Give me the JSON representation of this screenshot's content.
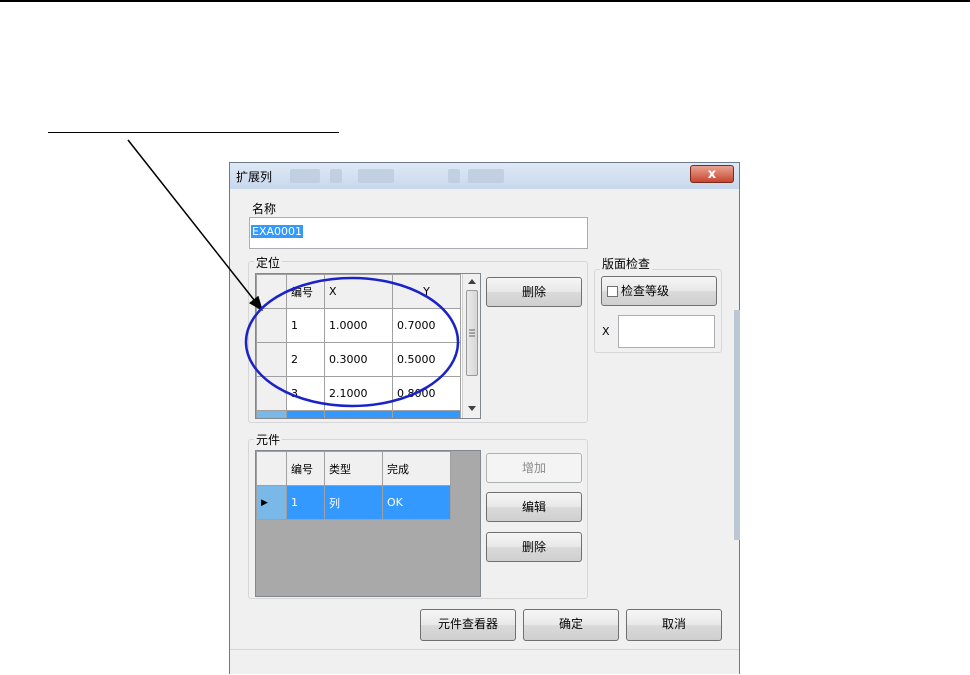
{
  "window": {
    "title": "扩展列",
    "close_glyph": "x"
  },
  "name_group": {
    "label": "名称",
    "value": "EXA0001"
  },
  "position_group": {
    "label": "定位",
    "columns": [
      "编号",
      "X",
      "Y"
    ],
    "rows": [
      [
        "1",
        "1.0000",
        "0.7000"
      ],
      [
        "2",
        "0.3000",
        "0.5000"
      ],
      [
        "3",
        "2.1000",
        "0.8000"
      ]
    ],
    "delete_label": "删除"
  },
  "inspection_group": {
    "label": "版面检查",
    "check_grade_label": "检查等级",
    "check_grade_checked": false,
    "x_label": "X",
    "x_value": ""
  },
  "components_group": {
    "label": "元件",
    "columns": [
      "编号",
      "类型",
      "完成"
    ],
    "rows": [
      [
        "1",
        "列",
        "OK"
      ]
    ],
    "add_label": "增加",
    "edit_label": "编辑",
    "delete_label": "删除"
  },
  "footer": {
    "viewer_label": "元件查看器",
    "ok_label": "确定",
    "cancel_label": "取消"
  },
  "colors": {
    "selection": "#3399ff",
    "annotation_ellipse": "#1a22c8",
    "close_button": "#c7452e"
  }
}
